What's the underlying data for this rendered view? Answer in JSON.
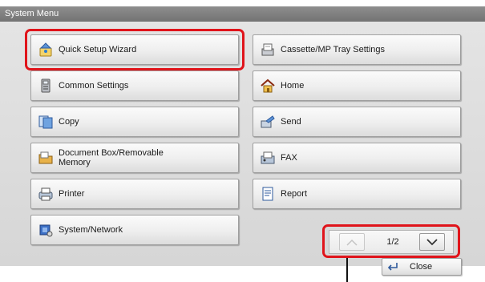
{
  "window": {
    "title": "System Menu"
  },
  "menu": {
    "quick_setup": "Quick Setup Wizard",
    "cassette": "Cassette/MP Tray Settings",
    "common": "Common Settings",
    "home": "Home",
    "copy": "Copy",
    "send": "Send",
    "docbox": "Document Box/Removable Memory",
    "fax": "FAX",
    "printer": "Printer",
    "report": "Report",
    "system": "System/Network"
  },
  "pager": {
    "page": "1/2"
  },
  "close_label": "Close",
  "colors": {
    "highlight": "#e0141b",
    "titlebar": "#808080",
    "panel": "#dcdcdc"
  }
}
